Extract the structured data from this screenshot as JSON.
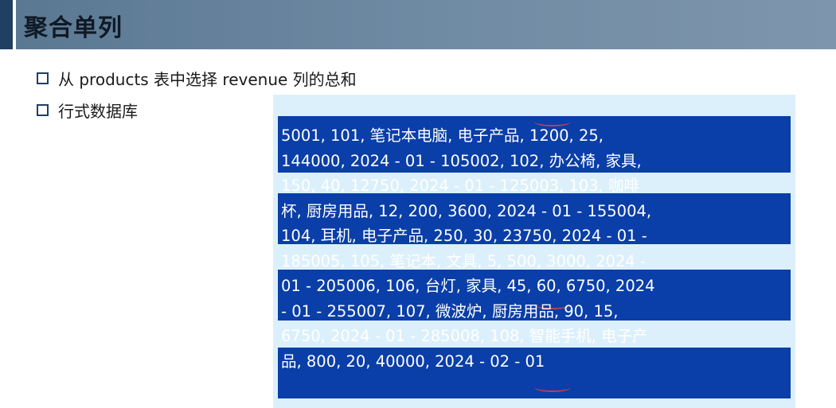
{
  "title": "聚合单列",
  "bullets": [
    "从 products 表中选择 revenue 列的总和",
    "行式数据库"
  ],
  "row_store_text": "5001, 101, 笔记本电脑, 电子产品, 1200, 25,\n144000, 2024 - 01 - 105002, 102, 办公椅, 家具,\n150, 40, 12750, 2024 - 01 - 125003, 103, 咖啡\n杯, 厨房用品, 12, 200, 3600, 2024 - 01 - 155004,\n104, 耳机, 电子产品, 250, 30, 23750, 2024 - 01 -\n185005, 105, 笔记本, 文具, 5, 500, 3000, 2024 -\n01 - 205006, 106, 台灯, 家具, 45, 60, 6750, 2024\n- 01 - 255007, 107, 微波炉, 厨房用品, 90, 15,\n6750, 2024 - 01 - 285008, 108, 智能手机, 电子产\n品, 800, 20, 40000, 2024 - 02 - 01",
  "colors": {
    "title_bar": "#6f8aa3",
    "accent": "#1f3f63",
    "panel_bg": "#dcf0fb",
    "row_band": "#0a3ea8",
    "highlight_arc": "#d9404a"
  }
}
